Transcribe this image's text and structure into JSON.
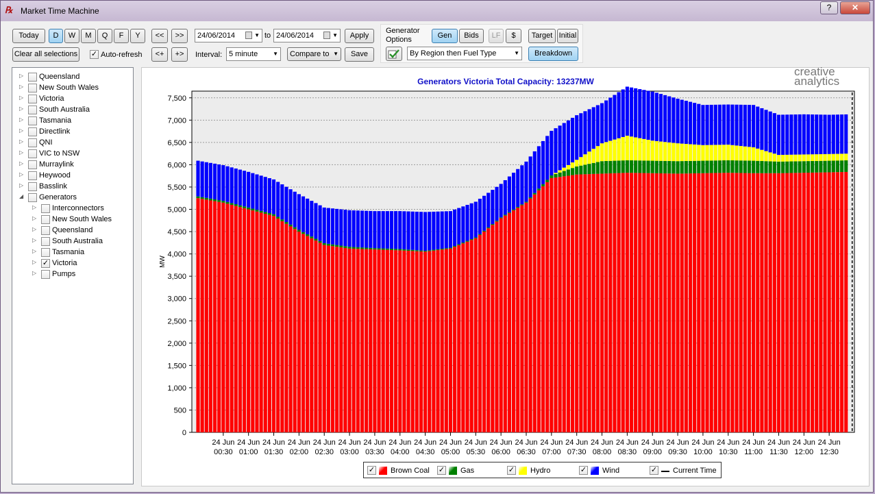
{
  "window": {
    "title": "Market Time Machine",
    "help": "?",
    "close": "✕"
  },
  "toolbar": {
    "today": "Today",
    "periods": [
      "D",
      "W",
      "M",
      "Q",
      "F",
      "Y"
    ],
    "active_period": "D",
    "prev": "<<",
    "next": ">>",
    "minus": "<+",
    "plus": "+>",
    "clear": "Clear all selections",
    "auto_refresh": "Auto-refresh",
    "auto_refresh_checked": true,
    "date_from": "24/06/2014",
    "to_label": "to",
    "date_to": "24/06/2014",
    "apply": "Apply",
    "interval_label": "Interval:",
    "interval_value": "5 minute",
    "compare": "Compare to",
    "save": "Save"
  },
  "generator_options": {
    "label_line1": "Generator",
    "label_line2": "Options",
    "gen": "Gen",
    "bids": "Bids",
    "lf": "LF",
    "dollar": "$",
    "target": "Target",
    "initial": "Initial",
    "grouping": "By Region then Fuel Type",
    "breakdown": "Breakdown"
  },
  "tree": {
    "top": [
      {
        "label": "Queensland",
        "checked": false
      },
      {
        "label": "New South Wales",
        "checked": false
      },
      {
        "label": "Victoria",
        "checked": false
      },
      {
        "label": "South Australia",
        "checked": false
      },
      {
        "label": "Tasmania",
        "checked": false
      },
      {
        "label": "Directlink",
        "checked": false
      },
      {
        "label": "QNI",
        "checked": false
      },
      {
        "label": "VIC to NSW",
        "checked": false
      },
      {
        "label": "Murraylink",
        "checked": false
      },
      {
        "label": "Heywood",
        "checked": false
      },
      {
        "label": "Basslink",
        "checked": false
      },
      {
        "label": "Generators",
        "checked": false,
        "expanded": true
      }
    ],
    "children": [
      {
        "label": "Interconnectors",
        "checked": false
      },
      {
        "label": "New South Wales",
        "checked": false
      },
      {
        "label": "Queensland",
        "checked": false
      },
      {
        "label": "South Australia",
        "checked": false
      },
      {
        "label": "Tasmania",
        "checked": false
      },
      {
        "label": "Victoria",
        "checked": true
      },
      {
        "label": "Pumps",
        "checked": false
      }
    ]
  },
  "logo": {
    "line1": "creative",
    "line2": "analytics"
  },
  "chart_data": {
    "type": "area",
    "title": "Generators Victoria Total Capacity: 13237MW",
    "ylabel": "MW",
    "ylim": [
      0,
      7500
    ],
    "yticks": [
      0,
      500,
      1000,
      1500,
      2000,
      2500,
      3000,
      3500,
      4000,
      4500,
      5000,
      5500,
      6000,
      6500,
      7000,
      7500
    ],
    "ytick_labels": [
      "0",
      "500",
      "1,000",
      "1,500",
      "2,000",
      "2,500",
      "3,000",
      "3,500",
      "4,000",
      "4,500",
      "5,000",
      "5,500",
      "6,000",
      "6,500",
      "7,000",
      "7,500"
    ],
    "xlim_hours": [
      0,
      13
    ],
    "x_tick_hours": [
      0.5,
      1,
      1.5,
      2,
      2.5,
      3,
      3.5,
      4,
      4.5,
      5,
      5.5,
      6,
      6.5,
      7,
      7.5,
      8,
      8.5,
      9,
      9.5,
      10,
      10.5,
      11,
      11.5,
      12,
      12.5
    ],
    "x_tick_labels": [
      [
        "24 Jun",
        "00:30"
      ],
      [
        "24 Jun",
        "01:00"
      ],
      [
        "24 Jun",
        "01:30"
      ],
      [
        "24 Jun",
        "02:00"
      ],
      [
        "24 Jun",
        "02:30"
      ],
      [
        "24 Jun",
        "03:00"
      ],
      [
        "24 Jun",
        "03:30"
      ],
      [
        "24 Jun",
        "04:00"
      ],
      [
        "24 Jun",
        "04:30"
      ],
      [
        "24 Jun",
        "05:00"
      ],
      [
        "24 Jun",
        "05:30"
      ],
      [
        "24 Jun",
        "06:00"
      ],
      [
        "24 Jun",
        "06:30"
      ],
      [
        "24 Jun",
        "07:00"
      ],
      [
        "24 Jun",
        "07:30"
      ],
      [
        "24 Jun",
        "08:00"
      ],
      [
        "24 Jun",
        "08:30"
      ],
      [
        "24 Jun",
        "09:00"
      ],
      [
        "24 Jun",
        "09:30"
      ],
      [
        "24 Jun",
        "10:00"
      ],
      [
        "24 Jun",
        "10:30"
      ],
      [
        "24 Jun",
        "11:00"
      ],
      [
        "24 Jun",
        "11:30"
      ],
      [
        "24 Jun",
        "12:00"
      ],
      [
        "24 Jun",
        "12:30"
      ]
    ],
    "stacked": true,
    "current_time_hours": 12.9,
    "series": [
      {
        "name": "Brown Coal",
        "color": "#ff0000",
        "hours": [
          0,
          0.5,
          1,
          1.5,
          2,
          2.5,
          3,
          3.5,
          4,
          4.5,
          5,
          5.5,
          6,
          6.5,
          7,
          7.5,
          8,
          8.5,
          9,
          9.5,
          10,
          10.5,
          11,
          11.5,
          12,
          12.5,
          12.9
        ],
        "values": [
          5250,
          5150,
          5000,
          4850,
          4500,
          4200,
          4120,
          4100,
          4080,
          4050,
          4120,
          4350,
          4800,
          5150,
          5700,
          5780,
          5800,
          5820,
          5810,
          5800,
          5810,
          5820,
          5810,
          5810,
          5820,
          5830,
          5840
        ]
      },
      {
        "name": "Gas",
        "color": "#008000",
        "hours": [
          0,
          0.5,
          1,
          1.5,
          2,
          2.5,
          3,
          3.5,
          4,
          4.5,
          5,
          5.5,
          6,
          6.5,
          7,
          7.5,
          8,
          8.5,
          9,
          9.5,
          10,
          10.5,
          11,
          11.5,
          12,
          12.5,
          12.9
        ],
        "values": [
          40,
          40,
          40,
          40,
          40,
          40,
          40,
          30,
          30,
          20,
          20,
          20,
          20,
          20,
          60,
          180,
          280,
          280,
          280,
          280,
          280,
          280,
          280,
          260,
          260,
          260,
          260
        ]
      },
      {
        "name": "Hydro",
        "color": "#ffff00",
        "hours": [
          0,
          0.5,
          1,
          1.5,
          2,
          2.5,
          3,
          3.5,
          4,
          4.5,
          5,
          5.5,
          6,
          6.5,
          7,
          7.5,
          8,
          8.5,
          9,
          9.5,
          10,
          10.5,
          11,
          11.5,
          12,
          12.5,
          12.9
        ],
        "values": [
          0,
          0,
          0,
          0,
          0,
          0,
          0,
          0,
          0,
          0,
          0,
          0,
          0,
          0,
          0,
          150,
          400,
          550,
          450,
          400,
          350,
          350,
          300,
          150,
          150,
          150,
          150
        ]
      },
      {
        "name": "Wind",
        "color": "#0000ff",
        "hours": [
          0,
          0.5,
          1,
          1.5,
          2,
          2.5,
          3,
          3.5,
          4,
          4.5,
          5,
          5.5,
          6,
          6.5,
          7,
          7.5,
          8,
          8.5,
          9,
          9.5,
          10,
          10.5,
          11,
          11.5,
          12,
          12.5,
          12.9
        ],
        "values": [
          800,
          800,
          800,
          780,
          800,
          800,
          820,
          830,
          850,
          870,
          820,
          800,
          750,
          900,
          1000,
          1000,
          900,
          1100,
          1100,
          1000,
          900,
          900,
          950,
          900,
          900,
          880,
          880
        ]
      }
    ],
    "legend": [
      {
        "name": "Brown Coal",
        "color": "#ff0000"
      },
      {
        "name": "Gas",
        "color": "#008000"
      },
      {
        "name": "Hydro",
        "color": "#ffff00"
      },
      {
        "name": "Wind",
        "color": "#0000ff"
      },
      {
        "name": "Current Time",
        "color": "#000000",
        "dashed": true
      }
    ]
  }
}
